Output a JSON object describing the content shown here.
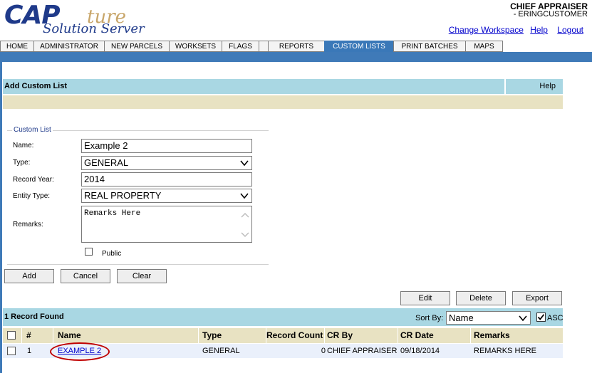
{
  "header": {
    "logo_main": "CAP",
    "logo_script": "ture",
    "logo_sub": "Solution Server",
    "user_role": "CHIEF  APPRAISER",
    "user_name": "- ERINGCUSTOMER",
    "links": {
      "change_workspace": "Change Workspace",
      "help": "Help",
      "logout": "Logout"
    }
  },
  "nav": {
    "tabs": [
      "HOME",
      "ADMINISTRATOR",
      "NEW PARCELS",
      "WORKSETS",
      "FLAGS",
      "",
      "REPORTS",
      "CUSTOM LISTS",
      "PRINT BATCHES",
      "MAPS"
    ],
    "active": "CUSTOM LISTS"
  },
  "titlebar": {
    "title": "Add Custom List",
    "help": "Help"
  },
  "form": {
    "legend": "Custom List",
    "name_label": "Name:",
    "name_value": "Example 2",
    "type_label": "Type:",
    "type_value": "GENERAL",
    "record_year_label": "Record Year:",
    "record_year_value": "2014",
    "entity_type_label": "Entity Type:",
    "entity_type_value": "REAL PROPERTY",
    "remarks_label": "Remarks:",
    "remarks_value": "Remarks Here",
    "public_label": "Public",
    "public_checked": false
  },
  "actions": {
    "add": "Add",
    "cancel": "Cancel",
    "clear": "Clear",
    "edit": "Edit",
    "delete": "Delete",
    "export": "Export"
  },
  "results": {
    "count_text": "1 Record Found",
    "sort_label": "Sort By:",
    "sort_value": "Name",
    "asc_label": "ASC",
    "asc_checked": true,
    "columns": {
      "num": "#",
      "name": "Name",
      "type": "Type",
      "record_count": "Record Count",
      "cr_by": "CR By",
      "cr_date": "CR Date",
      "remarks": "Remarks"
    },
    "rows": [
      {
        "num": "1",
        "name": "EXAMPLE 2",
        "type": "GENERAL",
        "record_count": "0",
        "cr_by": "CHIEF APPRAISER",
        "cr_date": "09/18/2014",
        "remarks": "REMARKS HERE"
      }
    ]
  },
  "colors": {
    "nav_blue": "#3f7ab8",
    "header_bar": "#a9d7e3",
    "tan_bar": "#e8e2c2",
    "row_bg": "#eaf0fb",
    "highlight": "#c00000"
  }
}
